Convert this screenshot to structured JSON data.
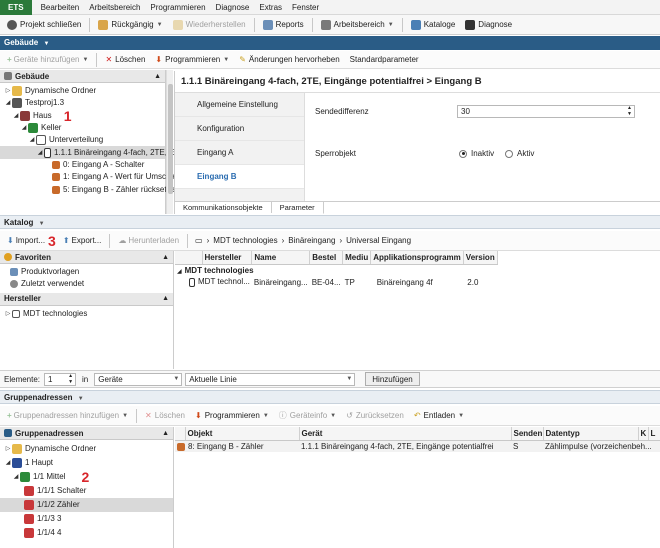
{
  "menubar": {
    "app": "ETS",
    "items": [
      "Bearbeiten",
      "Arbeitsbereich",
      "Programmieren",
      "Diagnose",
      "Extras",
      "Fenster"
    ]
  },
  "toolbar": {
    "close_project": "Projekt schließen",
    "undo": "Rückgängig",
    "redo": "Wiederherstellen",
    "reports": "Reports",
    "workspace": "Arbeitsbereich",
    "catalogs": "Kataloge",
    "diagnostics": "Diagnose"
  },
  "buildings": {
    "section_title": "Gebäude",
    "toolbar": {
      "add_devices": "Geräte hinzufügen",
      "delete": "Löschen",
      "program": "Programmieren",
      "apply_changes": "Änderungen hervorheben",
      "default_params": "Standardparameter"
    },
    "panel_title": "Gebäude",
    "tree": [
      "Dynamische Ordner",
      "Testproj1.3",
      "Haus",
      "Keller",
      "Unterverteilung",
      "1.1.1 Binäreingang 4-fach, 2TE, Ein...",
      "0: Eingang A - Schalter",
      "1: Eingang A - Wert für Umschalt...",
      "5: Eingang B - Zähler rücksetzen"
    ],
    "marker": "1"
  },
  "params": {
    "title": "1.1.1 Binäreingang 4-fach, 2TE, Eingänge potentialfrei > Eingang B",
    "tabs": [
      "Allgemeine Einstellung",
      "Konfiguration",
      "Eingang A",
      "Eingang B"
    ],
    "send_diff_label": "Sendedifferenz",
    "send_diff_value": "30",
    "lock_label": "Sperrobjekt",
    "opt_inactive": "Inaktiv",
    "opt_active": "Aktiv",
    "bottom_tabs": [
      "Kommunikationsobjekte",
      "Parameter"
    ]
  },
  "catalog": {
    "section_title": "Katalog",
    "toolbar": {
      "import": "Import...",
      "export": "Export...",
      "download": "Herunterladen"
    },
    "breadcrumb": [
      "MDT technologies",
      "Binäreingang",
      "Universal Eingang"
    ],
    "marker": "3",
    "favorites_title": "Favoriten",
    "favorites": [
      "Produktvorlagen",
      "Zuletzt verwendet"
    ],
    "manufacturer_title": "Hersteller",
    "manufacturers": [
      "MDT technologies"
    ],
    "columns": [
      "Hersteller",
      "Name",
      "Bestel",
      "Mediu",
      "Applikationsprogramm",
      "Version"
    ],
    "group_label": "MDT technologies",
    "rows": [
      {
        "hersteller": "MDT technol...",
        "name": "Binäreingang...",
        "bestel": "BE-04...",
        "medium": "TP",
        "app": "Binäreingang 4f",
        "version": "2.0"
      }
    ]
  },
  "elements_bar": {
    "label": "Elemente:",
    "count": "1",
    "in": "in",
    "target": "Geräte",
    "line": "Aktuelle Linie",
    "add": "Hinzufügen"
  },
  "group_addresses": {
    "section_title": "Gruppenadressen",
    "toolbar": {
      "add": "Gruppenadressen hinzufügen",
      "delete": "Löschen",
      "program": "Programmieren",
      "device_info": "Geräteinfo",
      "reset": "Zurücksetzen",
      "unload": "Entladen"
    },
    "panel_title": "Gruppenadressen",
    "tree": [
      "Dynamische Ordner",
      "1 Haupt",
      "1/1 Mittel",
      "1/1/1 Schalter",
      "1/1/2 Zähler",
      "1/1/3 3",
      "1/1/4 4"
    ],
    "marker": "2",
    "columns": [
      "Objekt",
      "Gerät",
      "Senden",
      "Datentyp",
      "K",
      "L"
    ],
    "rows": [
      {
        "object": "8: Eingang B - Zähler",
        "device": "1.1.1 Binäreingang 4-fach, 2TE, Eingänge potentialfrei",
        "send": "S",
        "datatype": "Zählimpulse (vorzeichenbeh..."
      }
    ]
  }
}
